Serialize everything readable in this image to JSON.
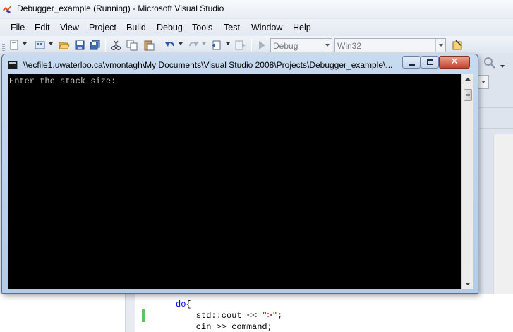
{
  "vs_window": {
    "title": "Debugger_example (Running) - Microsoft Visual Studio"
  },
  "menu": [
    "File",
    "Edit",
    "View",
    "Project",
    "Build",
    "Debug",
    "Tools",
    "Test",
    "Window",
    "Help"
  ],
  "toolbar": {
    "solution_config": "Debug",
    "solution_platform": "Win32"
  },
  "console": {
    "title": "\\\\ecfile1.uwaterloo.ca\\vmontagh\\My Documents\\Visual Studio 2008\\Projects\\Debugger_example\\...",
    "output": "Enter the stack size:",
    "buttons": {
      "minimize": "minimize-icon",
      "maximize": "maximize-icon",
      "close": "close-icon"
    }
  },
  "editor": {
    "lines": [
      {
        "prefix": "",
        "keyword": "do",
        "rest": "{"
      },
      {
        "prefix": "    std::cout << ",
        "string": "\">\"",
        "rest": ";"
      },
      {
        "prefix": "    cin >> command;"
      }
    ]
  },
  "colors": {
    "console_bg": "#000000",
    "console_text": "#c0c0c0",
    "keyword": "#0000ff",
    "string": "#a31515",
    "close_button": "#c7452a"
  }
}
